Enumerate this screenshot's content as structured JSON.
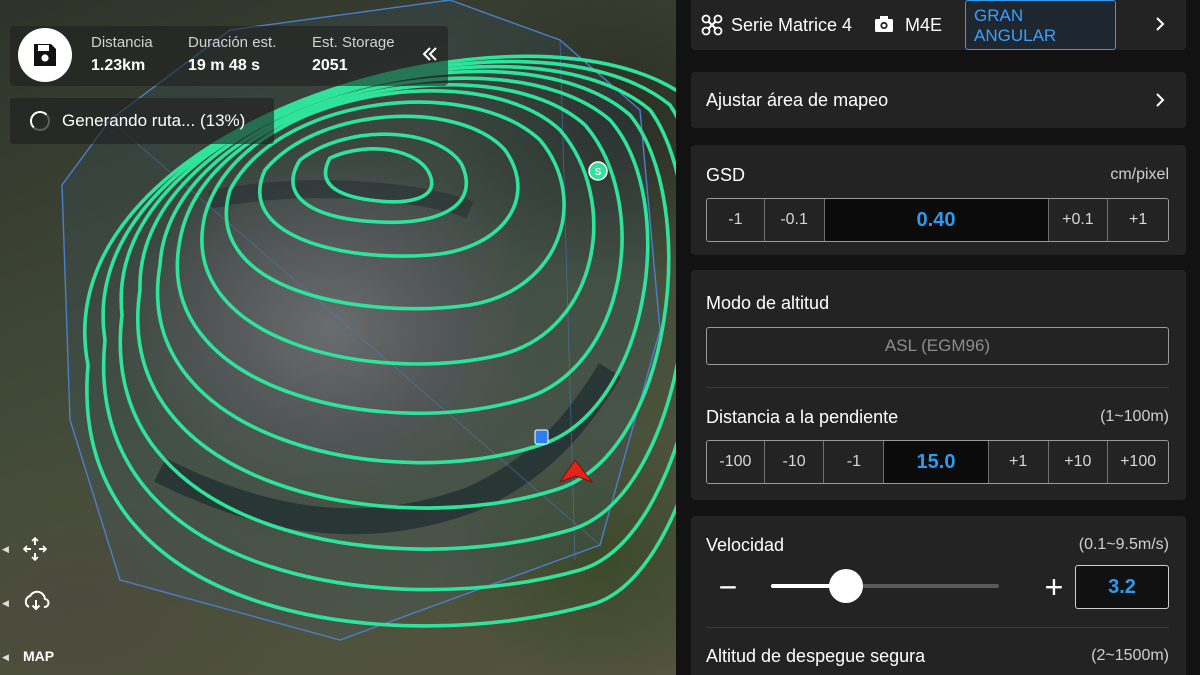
{
  "stats": {
    "distance": {
      "label": "Distancia",
      "value": "1.23km"
    },
    "duration": {
      "label": "Duración est.",
      "value": "19 m 48 s"
    },
    "storage": {
      "label": "Est. Storage",
      "value": "2051"
    }
  },
  "status": {
    "text": "Generando ruta... (13%)"
  },
  "map": {
    "label": "MAP",
    "start_marker": "S"
  },
  "drone": {
    "series": "Serie Matrice 4",
    "camera": "M4E",
    "lens_line1": "GRAN",
    "lens_line2": "ANGULAR"
  },
  "mapping_area": {
    "label": "Ajustar área de mapeo"
  },
  "gsd": {
    "title": "GSD",
    "unit": "cm/pixel",
    "value": "0.40",
    "steps": {
      "minus1": "-1",
      "minus01": "-0.1",
      "plus01": "+0.1",
      "plus1": "+1"
    }
  },
  "altitude_mode": {
    "title": "Modo de altitud",
    "value": "ASL (EGM96)"
  },
  "slope_distance": {
    "title": "Distancia a la pendiente",
    "range": "(1~100m)",
    "value": "15.0",
    "steps": {
      "m100": "-100",
      "m10": "-10",
      "m1": "-1",
      "p1": "+1",
      "p10": "+10",
      "p100": "+100"
    }
  },
  "speed": {
    "title": "Velocidad",
    "range": "(0.1~9.5m/s)",
    "value": "3.2",
    "level": 0.33,
    "minus": "−",
    "plus": "+"
  },
  "takeoff": {
    "title": "Altitud de despegue segura",
    "range": "(2~1500m)"
  },
  "colors": {
    "accent": "#2d9bf0",
    "route": "#2fe39a",
    "panel_bg": "#121212",
    "card_bg": "#232323",
    "aircraft": "#e2231a"
  }
}
